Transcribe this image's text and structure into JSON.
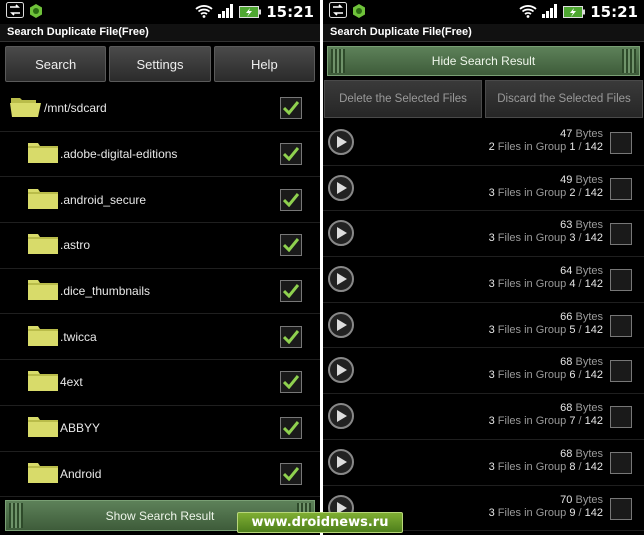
{
  "status": {
    "time": "15:21"
  },
  "left": {
    "title": "Search Duplicate File(Free)",
    "buttons": {
      "search": "Search",
      "settings": "Settings",
      "help": "Help"
    },
    "folders": [
      {
        "name": "/mnt/sdcard",
        "checked": true
      },
      {
        "name": ".adobe-digital-editions",
        "checked": true
      },
      {
        "name": ".android_secure",
        "checked": true
      },
      {
        "name": ".astro",
        "checked": true
      },
      {
        "name": ".dice_thumbnails",
        "checked": true
      },
      {
        "name": ".twicca",
        "checked": true
      },
      {
        "name": "4ext",
        "checked": true
      },
      {
        "name": "ABBYY",
        "checked": true
      },
      {
        "name": "Android",
        "checked": true
      }
    ],
    "bottom_button": "Show Search Result"
  },
  "right": {
    "title": "Search Duplicate File(Free)",
    "hide_button": "Hide Search Result",
    "delete_button": "Delete the Selected Files",
    "discard_button": "Discard the Selected Files",
    "bytes_label": "Bytes",
    "files_label": "Files in Group",
    "groups": [
      {
        "size": "47",
        "files": "2",
        "group": "1",
        "total": "142"
      },
      {
        "size": "49",
        "files": "3",
        "group": "2",
        "total": "142"
      },
      {
        "size": "63",
        "files": "3",
        "group": "3",
        "total": "142"
      },
      {
        "size": "64",
        "files": "3",
        "group": "4",
        "total": "142"
      },
      {
        "size": "66",
        "files": "3",
        "group": "5",
        "total": "142"
      },
      {
        "size": "68",
        "files": "3",
        "group": "6",
        "total": "142"
      },
      {
        "size": "68",
        "files": "3",
        "group": "7",
        "total": "142"
      },
      {
        "size": "68",
        "files": "3",
        "group": "8",
        "total": "142"
      },
      {
        "size": "70",
        "files": "3",
        "group": "9",
        "total": "142"
      }
    ]
  },
  "watermark": "www.droidnews.ru",
  "colors": {
    "check": "#8fd14f",
    "folder": "#d8db6a",
    "accent_green": "#4e7049"
  }
}
